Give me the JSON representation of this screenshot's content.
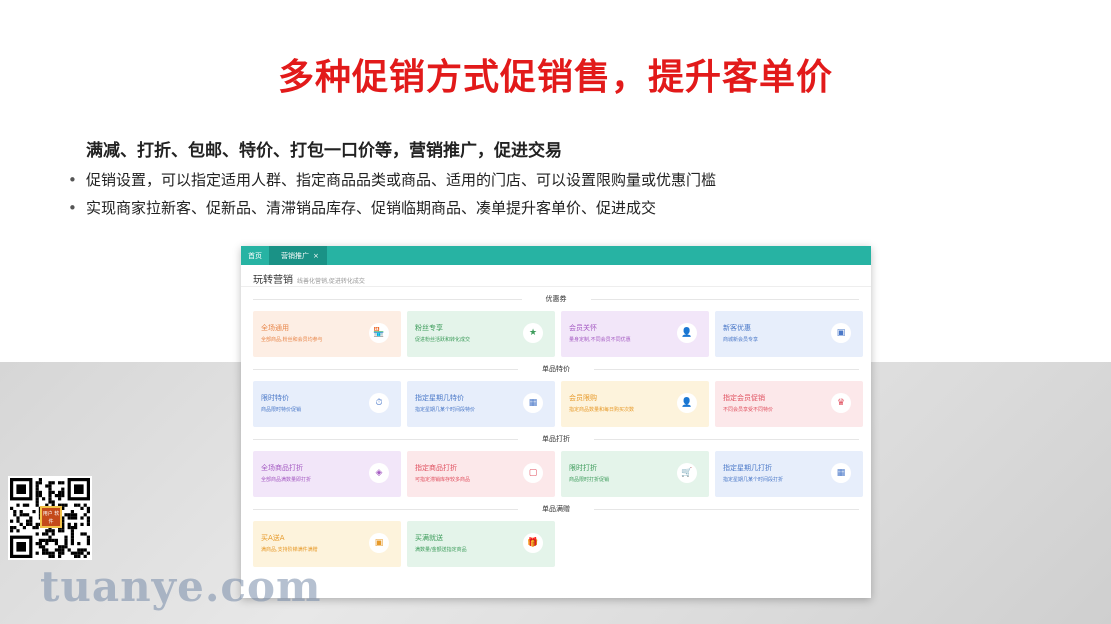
{
  "slide": {
    "title": "多种促销方式促销售，提升客单价",
    "subtitle": "满减、打折、包邮、特价、打包一口价等，营销推广，促进交易",
    "bullets": [
      "促销设置，可以指定适用人群、指定商品品类或商品、适用的门店、可以设置限购量或优惠门槛",
      "实现商家拉新客、促新品、清滞销品库存、促销临期商品、凑单提升客单价、促进成交"
    ],
    "bullet_symbol": "•",
    "watermark": "tuanye.com",
    "qr_badge": "用户 软件"
  },
  "app": {
    "tabs": [
      {
        "label": "首页"
      },
      {
        "label": "营销推广",
        "close": "×"
      }
    ],
    "page_title": "玩转营销",
    "page_subtitle": "线善化营销,促进转化成交",
    "sections": [
      {
        "label": "优惠券",
        "cards": [
          {
            "title": "全场通用",
            "desc": "全部商品,粉丝和会员均参与",
            "icon": "store-icon",
            "glyph": "🏪",
            "color": "orange"
          },
          {
            "title": "粉丝专享",
            "desc": "促进粉丝活跃和转化成交",
            "icon": "star-icon",
            "glyph": "★",
            "color": "green"
          },
          {
            "title": "会员关怀",
            "desc": "量身定制,不同会员不同优惠",
            "icon": "member-icon",
            "glyph": "👤",
            "color": "purple"
          },
          {
            "title": "新客优惠",
            "desc": "商城新会员专享",
            "icon": "card-icon",
            "glyph": "▣",
            "color": "blue"
          }
        ]
      },
      {
        "label": "单品特价",
        "cards": [
          {
            "title": "限时特价",
            "desc": "商品限时特价促销",
            "icon": "timer-icon",
            "glyph": "⏱",
            "color": "blue"
          },
          {
            "title": "指定星期几特价",
            "desc": "指定星期几某个时间段特价",
            "icon": "calendar-icon",
            "glyph": "▦",
            "color": "blue"
          },
          {
            "title": "会员限购",
            "desc": "指定商品数量和每日购买次数",
            "icon": "member-limit-icon",
            "glyph": "👤",
            "color": "yellow"
          },
          {
            "title": "指定会员促销",
            "desc": "不同会员享受不同特价",
            "icon": "crown-icon",
            "glyph": "♛",
            "color": "pink"
          }
        ]
      },
      {
        "label": "单品打折",
        "cards": [
          {
            "title": "全场商品打折",
            "desc": "全部商品满数量即打折",
            "icon": "tag-icon",
            "glyph": "◈",
            "color": "purple"
          },
          {
            "title": "指定商品打折",
            "desc": "可指定滞销库存较多商品",
            "icon": "bag-icon",
            "glyph": "▢",
            "color": "pink"
          },
          {
            "title": "限时打折",
            "desc": "商品限时打折促销",
            "icon": "cart-icon",
            "glyph": "🛒",
            "color": "green"
          },
          {
            "title": "指定星期几打折",
            "desc": "指定星期几某个时间段打折",
            "icon": "calendar-icon",
            "glyph": "▦",
            "color": "blue"
          }
        ]
      },
      {
        "label": "单品满赠",
        "cards": [
          {
            "title": "买A送A",
            "desc": "满商品,支持阶梯满件满赠",
            "icon": "box-icon",
            "glyph": "▣",
            "color": "yellow"
          },
          {
            "title": "买满就送",
            "desc": "满数量/金额送指定商品",
            "icon": "gift-icon",
            "glyph": "🎁",
            "color": "green"
          }
        ]
      }
    ]
  }
}
